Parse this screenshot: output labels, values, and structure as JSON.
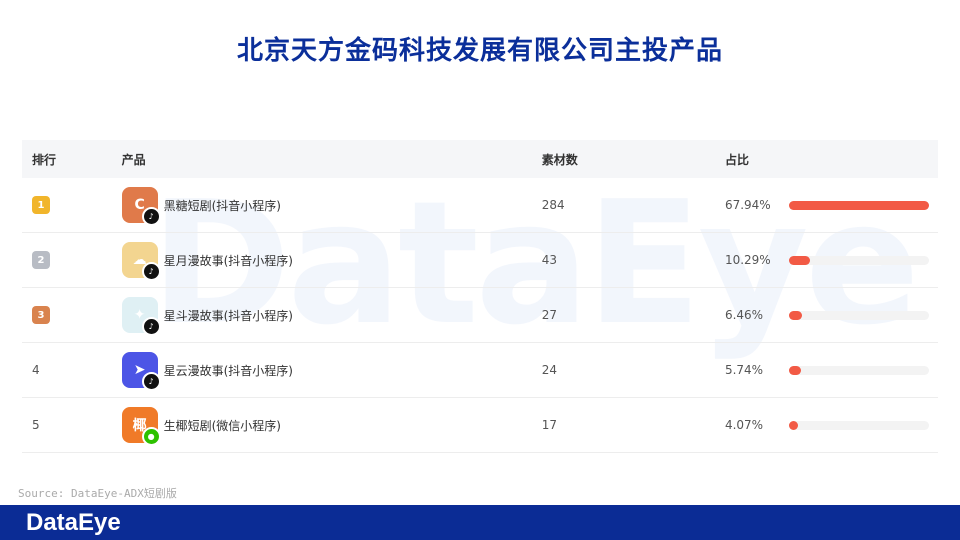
{
  "title": "北京天方金码科技发展有限公司主投产品",
  "watermark": "DataEye",
  "table": {
    "headers": {
      "rank": "排行",
      "product": "产品",
      "count": "素材数",
      "pct": "占比"
    },
    "rows": [
      {
        "rank": "1",
        "name": "黑糖短剧(抖音小程序)",
        "count": "284",
        "pct": "67.94%",
        "share": 0.6794,
        "icon_color": "#e07a4a",
        "icon_glyph": "C",
        "badge": "tiktok-icon",
        "medal_color": "#f1b52b"
      },
      {
        "rank": "2",
        "name": "星月漫故事(抖音小程序)",
        "count": "43",
        "pct": "10.29%",
        "share": 0.1029,
        "icon_color": "#f3d590",
        "icon_glyph": "☁",
        "badge": "tiktok-icon",
        "medal_color": "#b8bcc4"
      },
      {
        "rank": "3",
        "name": "星斗漫故事(抖音小程序)",
        "count": "27",
        "pct": "6.46%",
        "share": 0.0646,
        "icon_color": "#dff0f4",
        "icon_glyph": "✦",
        "badge": "tiktok-icon",
        "medal_color": "#d9834e"
      },
      {
        "rank": "4",
        "name": "星云漫故事(抖音小程序)",
        "count": "24",
        "pct": "5.74%",
        "share": 0.0574,
        "icon_color": "#4c55e6",
        "icon_glyph": "➤",
        "badge": "tiktok-icon",
        "medal_color": ""
      },
      {
        "rank": "5",
        "name": "生椰短剧(微信小程序)",
        "count": "17",
        "pct": "4.07%",
        "share": 0.0407,
        "icon_color": "#f07a28",
        "icon_glyph": "椰",
        "badge": "wechat-icon",
        "medal_color": ""
      }
    ]
  },
  "source": "Source: DataEye-ADX短剧版",
  "footer": {
    "logo": "DataEye",
    "color": "#0b2c95"
  },
  "colors": {
    "accent": "#f25a45",
    "title": "#0b2f9a"
  }
}
